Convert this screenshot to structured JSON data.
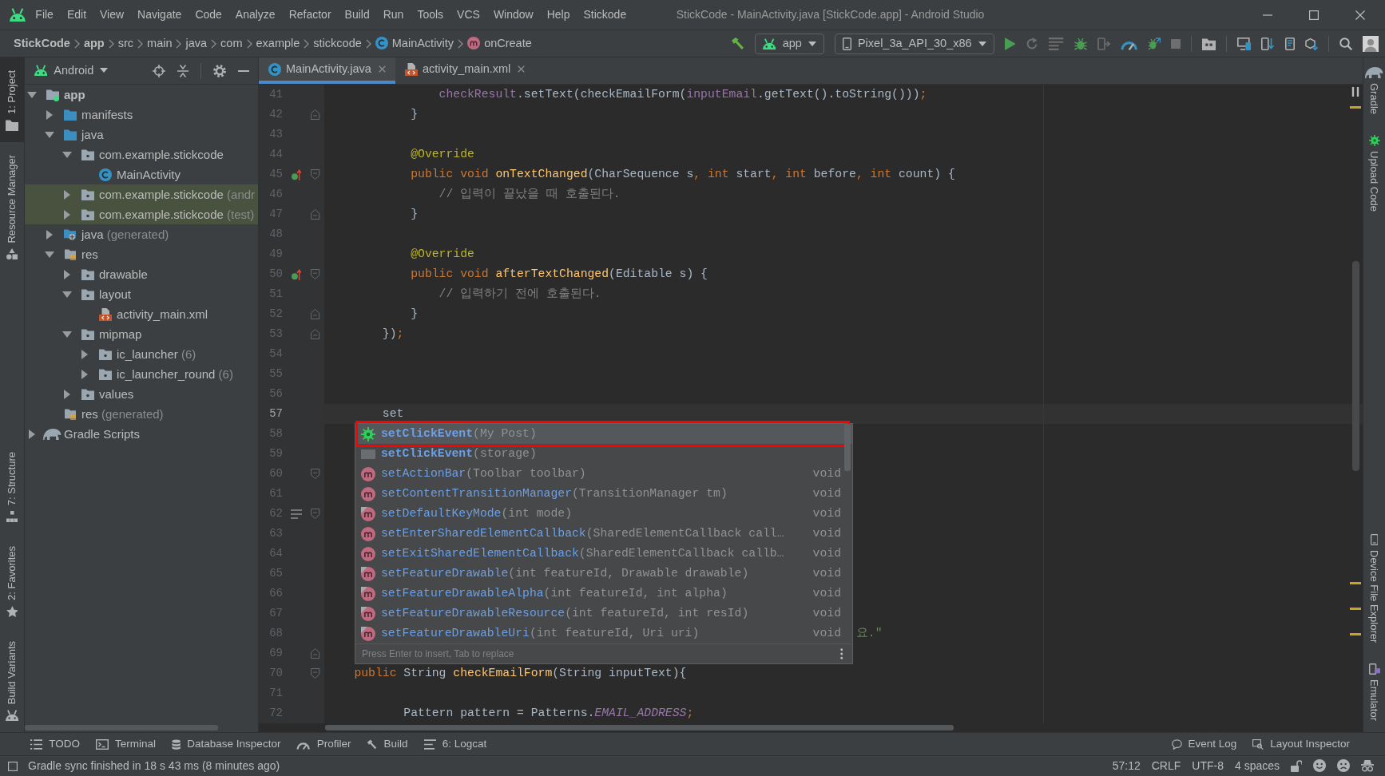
{
  "window": {
    "title": "StickCode - MainActivity.java [StickCode.app] - Android Studio"
  },
  "menu": [
    "File",
    "Edit",
    "View",
    "Navigate",
    "Code",
    "Analyze",
    "Refactor",
    "Build",
    "Run",
    "Tools",
    "VCS",
    "Window",
    "Help",
    "Stickode"
  ],
  "breadcrumb": [
    {
      "label": "StickCode",
      "kind": "module"
    },
    {
      "label": "app",
      "kind": "module"
    },
    {
      "label": "src",
      "kind": "folder"
    },
    {
      "label": "main",
      "kind": "folder"
    },
    {
      "label": "java",
      "kind": "folder"
    },
    {
      "label": "com",
      "kind": "folder"
    },
    {
      "label": "example",
      "kind": "folder"
    },
    {
      "label": "stickcode",
      "kind": "folder"
    },
    {
      "label": "MainActivity",
      "kind": "class"
    },
    {
      "label": "onCreate",
      "kind": "method"
    }
  ],
  "run_config": {
    "label": "app"
  },
  "device": {
    "label": "Pixel_3a_API_30_x86"
  },
  "left_tool_windows": {
    "top": [
      {
        "label": "1: Project",
        "kind": "project",
        "selected": true
      },
      {
        "label": "Resource Manager",
        "kind": "resources",
        "selected": false
      }
    ],
    "bottom": [
      {
        "label": "7: Structure",
        "kind": "structure",
        "selected": false
      },
      {
        "label": "2: Favorites",
        "kind": "favorites",
        "selected": false
      },
      {
        "label": "Build Variants",
        "kind": "variants",
        "selected": false
      }
    ]
  },
  "right_tool_windows": {
    "top": [
      {
        "label": "Gradle",
        "kind": "gradle",
        "selected": false
      },
      {
        "label": "Upload Code",
        "kind": "plugin",
        "selected": false
      }
    ],
    "bottom": [
      {
        "label": "Device File Explorer",
        "kind": "files",
        "selected": false
      },
      {
        "label": "Emulator",
        "kind": "emulator",
        "selected": false
      }
    ]
  },
  "project_panel": {
    "view": "Android",
    "tree": [
      {
        "label": "app",
        "kind": "module",
        "expanded": true,
        "highlighted": false,
        "children": [
          {
            "label": "manifests",
            "kind": "folder",
            "expanded": false,
            "highlighted": false
          },
          {
            "label": "java",
            "kind": "folder",
            "expanded": true,
            "highlighted": false,
            "children": [
              {
                "label": "com.example.stickcode",
                "kind": "dir",
                "expanded": true,
                "highlighted": false,
                "children": [
                  {
                    "label": "MainActivity",
                    "kind": "class",
                    "highlighted": false
                  }
                ]
              },
              {
                "label": "com.example.stickcode",
                "hint": "(andr",
                "kind": "dir",
                "expanded": false,
                "highlighted": true
              },
              {
                "label": "com.example.stickcode",
                "hint": "(test)",
                "kind": "dir",
                "expanded": false,
                "highlighted": true
              }
            ]
          },
          {
            "label": "java",
            "hint": "(generated)",
            "kind": "generated",
            "expanded": false,
            "highlighted": false
          },
          {
            "label": "res",
            "kind": "resources",
            "expanded": true,
            "highlighted": false,
            "children": [
              {
                "label": "drawable",
                "kind": "dir",
                "expanded": false,
                "highlighted": false
              },
              {
                "label": "layout",
                "kind": "dir",
                "expanded": true,
                "highlighted": false,
                "children": [
                  {
                    "label": "activity_main.xml",
                    "kind": "xml",
                    "highlighted": false
                  }
                ]
              },
              {
                "label": "mipmap",
                "kind": "dir",
                "expanded": true,
                "highlighted": false,
                "children": [
                  {
                    "label": "ic_launcher",
                    "hint": "(6)",
                    "kind": "dir",
                    "expanded": false,
                    "highlighted": false
                  },
                  {
                    "label": "ic_launcher_round",
                    "hint": "(6)",
                    "kind": "dir",
                    "expanded": false,
                    "highlighted": false
                  }
                ]
              },
              {
                "label": "values",
                "kind": "dir",
                "expanded": false,
                "highlighted": false
              }
            ]
          },
          {
            "label": "res",
            "hint": "(generated)",
            "kind": "resources",
            "highlighted": false
          }
        ]
      },
      {
        "label": "Gradle Scripts",
        "kind": "gradle",
        "expanded": false,
        "highlighted": false
      }
    ]
  },
  "editor": {
    "tabs": [
      {
        "label": "MainActivity.java",
        "kind": "java",
        "selected": true
      },
      {
        "label": "activity_main.xml",
        "kind": "xml",
        "selected": false
      }
    ],
    "lines": [
      {
        "number": "41",
        "current": false,
        "tokens": [
          {
            "kind": "field",
            "text": "                checkResult"
          },
          {
            "kind": "plain",
            "text": ".setText(checkEmailForm("
          },
          {
            "kind": "field",
            "text": "inputEmail"
          },
          {
            "kind": "plain",
            "text": ".getText().toString()))"
          },
          {
            "kind": "keyword",
            "text": ";"
          }
        ]
      },
      {
        "number": "42",
        "current": false,
        "gutter": [
          {
            "kind": "fold_end"
          }
        ],
        "tokens": [
          {
            "kind": "plain",
            "text": "            }"
          }
        ]
      },
      {
        "number": "43",
        "current": false
      },
      {
        "number": "44",
        "current": false,
        "tokens": [
          {
            "kind": "annotation",
            "text": "            @Override"
          }
        ]
      },
      {
        "number": "45",
        "current": false,
        "gutter": [
          {
            "kind": "override"
          },
          {
            "kind": "fold_start"
          }
        ],
        "tokens": [
          {
            "kind": "keyword",
            "text": "            public void "
          },
          {
            "kind": "method",
            "text": "onTextChanged"
          },
          {
            "kind": "plain",
            "text": "(CharSequence s"
          },
          {
            "kind": "keyword",
            "text": ", int "
          },
          {
            "kind": "plain",
            "text": "start"
          },
          {
            "kind": "keyword",
            "text": ", int "
          },
          {
            "kind": "plain",
            "text": "before"
          },
          {
            "kind": "keyword",
            "text": ", int "
          },
          {
            "kind": "plain",
            "text": "count) {"
          }
        ]
      },
      {
        "number": "46",
        "current": false,
        "tokens": [
          {
            "kind": "comment",
            "text": "                // 입력이 끝났을 때 호출된다."
          }
        ]
      },
      {
        "number": "47",
        "current": false,
        "gutter": [
          {
            "kind": "fold_end"
          }
        ],
        "tokens": [
          {
            "kind": "plain",
            "text": "            }"
          }
        ]
      },
      {
        "number": "48",
        "current": false
      },
      {
        "number": "49",
        "current": false,
        "tokens": [
          {
            "kind": "annotation",
            "text": "            @Override"
          }
        ]
      },
      {
        "number": "50",
        "current": false,
        "gutter": [
          {
            "kind": "override"
          },
          {
            "kind": "fold_start"
          }
        ],
        "tokens": [
          {
            "kind": "keyword",
            "text": "            public void "
          },
          {
            "kind": "method",
            "text": "afterTextChanged"
          },
          {
            "kind": "plain",
            "text": "(Editable s) {"
          }
        ]
      },
      {
        "number": "51",
        "current": false,
        "tokens": [
          {
            "kind": "comment",
            "text": "                // 입력하기 전에 호출된다."
          }
        ]
      },
      {
        "number": "52",
        "current": false,
        "gutter": [
          {
            "kind": "fold_end"
          }
        ],
        "tokens": [
          {
            "kind": "plain",
            "text": "            }"
          }
        ]
      },
      {
        "number": "53",
        "current": false,
        "gutter": [
          {
            "kind": "fold_end"
          }
        ],
        "tokens": [
          {
            "kind": "plain",
            "text": "        })"
          },
          {
            "kind": "keyword",
            "text": ";"
          }
        ]
      },
      {
        "number": "54",
        "current": false
      },
      {
        "number": "55",
        "current": false
      },
      {
        "number": "56",
        "current": false
      },
      {
        "number": "57",
        "current": true,
        "tokens": [
          {
            "kind": "plain",
            "text": "        set"
          }
        ]
      },
      {
        "number": "58",
        "current": false
      },
      {
        "number": "59",
        "current": false
      },
      {
        "number": "60",
        "current": false,
        "gutter": [
          {
            "kind": "fold_start"
          }
        ]
      },
      {
        "number": "61",
        "current": false
      },
      {
        "number": "62",
        "current": false,
        "gutter": [
          {
            "kind": "lines"
          },
          {
            "kind": "fold_start"
          }
        ]
      },
      {
        "number": "63",
        "current": false
      },
      {
        "number": "64",
        "current": false
      },
      {
        "number": "65",
        "current": false
      },
      {
        "number": "66",
        "current": false
      },
      {
        "number": "67",
        "current": false
      },
      {
        "number": "68",
        "current": false,
        "tokens": [
          {
            "kind": "string",
            "text": "                                                                           요.\""
          }
        ]
      },
      {
        "number": "69",
        "current": false,
        "gutter": [
          {
            "kind": "fold_end"
          }
        ]
      },
      {
        "number": "70",
        "current": false,
        "gutter": [
          {
            "kind": "fold_start"
          }
        ],
        "tokens": [
          {
            "kind": "keyword",
            "text": "    public "
          },
          {
            "kind": "plain",
            "text": "String "
          },
          {
            "kind": "method",
            "text": "checkEmailForm"
          },
          {
            "kind": "plain",
            "text": "(String inputText){"
          }
        ]
      },
      {
        "number": "71",
        "current": false
      },
      {
        "number": "72",
        "current": false,
        "tokens": [
          {
            "kind": "plain",
            "text": "           Pattern pattern = Patterns."
          },
          {
            "kind": "static",
            "text": "EMAIL_ADDRESS"
          },
          {
            "kind": "keyword",
            "text": ";"
          }
        ]
      }
    ],
    "completion": {
      "items": [
        {
          "kind": "plugin",
          "name": "setClickEvent",
          "params": "(My Post)",
          "selected": true,
          "outlined": true,
          "icon_overlay": false
        },
        {
          "kind": "template",
          "name": "setClickEvent",
          "params": "(storage)",
          "selected": false,
          "outlined": false,
          "icon_overlay": false
        },
        {
          "kind": "method",
          "name": "setActionBar",
          "params": "(Toolbar toolbar)",
          "type": "void",
          "selected": false,
          "outlined": false,
          "icon_overlay": false
        },
        {
          "kind": "method",
          "name": "setContentTransitionManager",
          "params": "(TransitionManager tm)",
          "type": "void",
          "selected": false,
          "outlined": false,
          "icon_overlay": false
        },
        {
          "kind": "method",
          "name": "setDefaultKeyMode",
          "params": "(int mode)",
          "type": "void",
          "selected": false,
          "outlined": false,
          "icon_overlay": true
        },
        {
          "kind": "method",
          "name": "setEnterSharedElementCallback",
          "params": "(SharedElementCallback call…",
          "type": "void",
          "selected": false,
          "outlined": false,
          "icon_overlay": false
        },
        {
          "kind": "method",
          "name": "setExitSharedElementCallback",
          "params": "(SharedElementCallback callb…",
          "type": "void",
          "selected": false,
          "outlined": false,
          "icon_overlay": false
        },
        {
          "kind": "method",
          "name": "setFeatureDrawable",
          "params": "(int featureId, Drawable drawable)",
          "type": "void",
          "selected": false,
          "outlined": false,
          "icon_overlay": true
        },
        {
          "kind": "method",
          "name": "setFeatureDrawableAlpha",
          "params": "(int featureId, int alpha)",
          "type": "void",
          "selected": false,
          "outlined": false,
          "icon_overlay": true
        },
        {
          "kind": "method",
          "name": "setFeatureDrawableResource",
          "params": "(int featureId, int resId)",
          "type": "void",
          "selected": false,
          "outlined": false,
          "icon_overlay": true
        },
        {
          "kind": "method",
          "name": "setFeatureDrawableUri",
          "params": "(int featureId, Uri uri)",
          "type": "void",
          "selected": false,
          "outlined": false,
          "icon_overlay": true
        }
      ],
      "hint": "Press Enter to insert, Tab to replace"
    }
  },
  "bottom_tool_windows": {
    "left": [
      {
        "label": "TODO",
        "kind": "todo"
      },
      {
        "label": "Terminal",
        "kind": "terminal"
      },
      {
        "label": "Database Inspector",
        "kind": "database"
      },
      {
        "label": "Profiler",
        "kind": "profiler"
      },
      {
        "label": "Build",
        "kind": "build"
      },
      {
        "label": "6: Logcat",
        "kind": "logcat"
      }
    ],
    "right": [
      {
        "label": "Event Log",
        "kind": "eventlog"
      },
      {
        "label": "Layout Inspector",
        "kind": "inspector"
      }
    ]
  },
  "status_bar": {
    "message": "Gradle sync finished in 18 s 43 ms (8 minutes ago)",
    "caret_position": "57:12",
    "line_separator": "CRLF",
    "encoding": "UTF-8",
    "indent": "4 spaces"
  }
}
